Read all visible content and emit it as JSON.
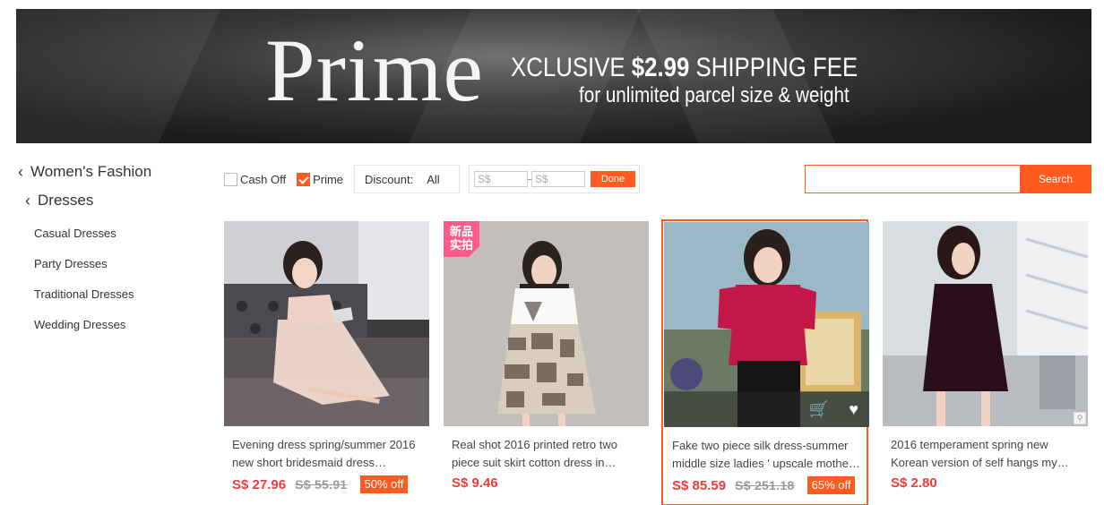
{
  "banner": {
    "prime": "Prime",
    "line1_prefix": "XCLUSIVE ",
    "line1_price": "$2.99",
    "line1_suffix": " SHIPPING FEE",
    "line2": "for unlimited parcel size & weight"
  },
  "sidebar": {
    "category": "Women's Fashion",
    "subcategory": "Dresses",
    "items": [
      {
        "label": "Casual Dresses"
      },
      {
        "label": "Party Dresses"
      },
      {
        "label": "Traditional Dresses"
      },
      {
        "label": "Wedding Dresses"
      }
    ]
  },
  "filters": {
    "cash_off": {
      "label": "Cash Off",
      "checked": false
    },
    "prime": {
      "label": "Prime",
      "checked": true
    },
    "discount_label": "Discount:",
    "discount_value": "All",
    "price_min_placeholder": "S$",
    "price_max_placeholder": "S$",
    "done_label": "Done"
  },
  "search": {
    "placeholder": "",
    "button": "Search"
  },
  "products": [
    {
      "title": "Evening dress spring/summer 2016 new short bridesmaid dress…",
      "price": "S$ 27.96",
      "old_price": "S$ 55.91",
      "discount": "50% off"
    },
    {
      "title": "Real shot 2016 printed retro two piece suit skirt cotton dress in…",
      "price": "S$ 9.46",
      "badge": "新品实拍"
    },
    {
      "title": "Fake two piece silk dress-summer middle size ladies ' upscale mothe…",
      "price": "S$ 85.59",
      "old_price": "S$ 251.18",
      "discount": "65% off",
      "highlighted": true
    },
    {
      "title": "2016 temperament spring new Korean version of self hangs my…",
      "price": "S$ 2.80"
    }
  ],
  "colors": {
    "accent": "#ff5a1f",
    "price": "#f23b3b"
  }
}
